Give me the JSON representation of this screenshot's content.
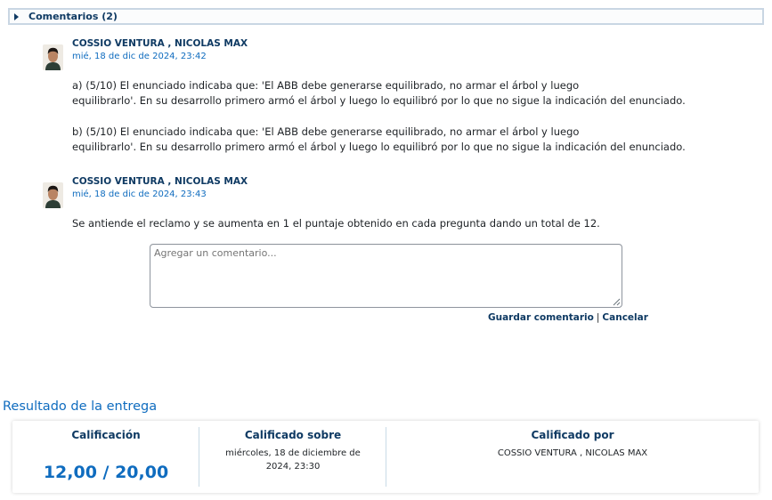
{
  "comments_section": {
    "title": "Comentarios (2)"
  },
  "comments": [
    {
      "author": "COSSIO VENTURA , NICOLAS MAX",
      "date": "mié, 18 de dic de 2024, 23:42",
      "paragraphs": [
        {
          "line1": "a) (5/10) El enunciado indicaba que: 'El ABB debe generarse equilibrado, no armar el árbol y luego",
          "line2": "equilibrarlo'. En su desarrollo primero armó el árbol y luego lo equilibró por lo que no sigue la indicación del enunciado."
        },
        {
          "line1": "b) (5/10) El enunciado indicaba que: 'El ABB debe generarse equilibrado, no armar el árbol y luego",
          "line2": "equilibrarlo'. En su desarrollo primero armó el árbol y luego lo equilibró por lo que no sigue la indicación del enunciado."
        }
      ]
    },
    {
      "author": "COSSIO VENTURA , NICOLAS MAX",
      "date": "mié, 18 de dic de 2024, 23:43",
      "text": "Se antiende el reclamo y se aumenta en 1 el puntaje obtenido en cada pregunta dando un total de 12."
    }
  ],
  "comment_form": {
    "placeholder": "Agregar un comentario...",
    "save_label": "Guardar comentario",
    "separator": "|",
    "cancel_label": "Cancelar"
  },
  "result": {
    "title": "Resultado de la entrega",
    "grade_label": "Calificación",
    "grade_value": "12,00 / 20,00",
    "graded_on_label": "Calificado sobre",
    "graded_on_value": "miércoles, 18 de diciembre de 2024, 23:30",
    "graded_by_label": "Calificado por",
    "graded_by_value": "COSSIO VENTURA , NICOLAS MAX"
  },
  "colors": {
    "link": "#0f6cbf",
    "heading": "#0f3a63",
    "text": "#1d2125"
  }
}
